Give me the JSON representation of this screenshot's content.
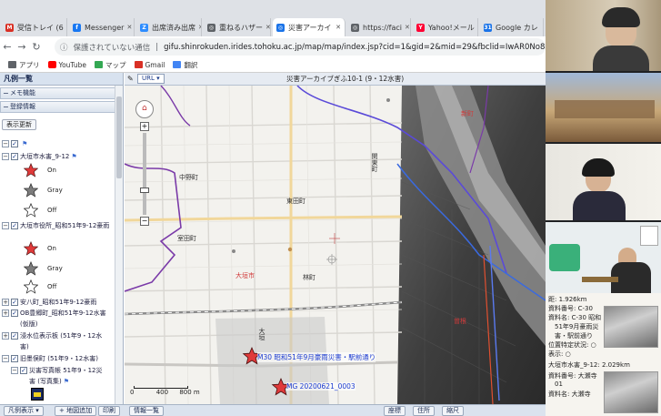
{
  "browser": {
    "tabs": [
      {
        "label": "受信トレイ (6",
        "icon": "gmail-icon",
        "color": "#d93025",
        "glyph": "M"
      },
      {
        "label": "Messenger",
        "icon": "facebook-icon",
        "color": "#1877f2",
        "glyph": "f"
      },
      {
        "label": "出席済み出席",
        "icon": "zoom-icon",
        "color": "#2d8cff",
        "glyph": "Z"
      },
      {
        "label": "重ねるハザー",
        "icon": "globe-icon",
        "color": "#5f6368",
        "glyph": "◎"
      },
      {
        "label": "災害アーカイ",
        "icon": "globe-icon",
        "color": "#1a73e8",
        "glyph": "◎"
      },
      {
        "label": "https://faci",
        "icon": "globe-icon",
        "color": "#5f6368",
        "glyph": "◎"
      },
      {
        "label": "Yahoo!メール",
        "icon": "yahoo-icon",
        "color": "#ff0033",
        "glyph": "Y"
      },
      {
        "label": "Google カレ",
        "icon": "calendar-icon",
        "color": "#1a73e8",
        "glyph": "31"
      }
    ],
    "security_label": "保護されていない通信",
    "url": "gifu.shinrokuden.irides.tohoku.ac.jp/map/map/index.jsp?cid=1&gid=2&mid=29&fbclid=IwAR0No8aXD45Rlp5mRfqQPr1QYL",
    "bookmarks": [
      {
        "label": "アプリ",
        "color": "#5f6368"
      },
      {
        "label": "YouTube",
        "color": "#ff0000"
      },
      {
        "label": "マップ",
        "color": "#34a853"
      },
      {
        "label": "Gmail",
        "color": "#d93025"
      },
      {
        "label": "翻訳",
        "color": "#4285f4"
      }
    ]
  },
  "legend": {
    "title": "凡例一覧",
    "memo_section": "メモ機能",
    "register_section": "登録情報",
    "refresh_button": "表示更新",
    "layers": [
      {
        "label": "大垣市水害_9-12",
        "checked": true
      },
      {
        "label": "大垣市役所_昭和51年9-12豪雨",
        "checked": true
      },
      {
        "label": "安八町_昭和51年9-12豪雨",
        "checked": true
      },
      {
        "label": "OB豊郷町_昭和51年9-12水害",
        "checked": true
      },
      {
        "label": "(仮版)",
        "checked": false
      },
      {
        "label": "浸水位表示板 (51年9・12水",
        "checked": true
      },
      {
        "label": "害)",
        "checked": false
      },
      {
        "label": "旧墨俣町 (51年9・12水害)",
        "checked": true
      },
      {
        "label": "災害写真帳 51年9・12災",
        "checked": true
      },
      {
        "label": "害 (写真集)",
        "checked": false
      }
    ],
    "star_states": [
      "On",
      "Gray",
      "Off"
    ],
    "bottom_label": "凡例表示"
  },
  "map": {
    "url_button": "URL",
    "title": "災害アーカイブぎふ10-1 (9・12水害)",
    "places": [
      {
        "label": "中野町"
      },
      {
        "label": "東田町"
      },
      {
        "label": "室田町"
      },
      {
        "label": "大垣市"
      },
      {
        "label": "林町"
      },
      {
        "label": "関東町"
      },
      {
        "label": "大垣"
      },
      {
        "label": "新町"
      },
      {
        "label": "曽根"
      }
    ],
    "markers": [
      {
        "label": "M30 昭和51年9月豪雨災害・駅前通り"
      },
      {
        "label": "MG 20200621_0003"
      }
    ],
    "scale": {
      "zero": "0",
      "mid": "400",
      "end": "800 m"
    }
  },
  "statusbar": {
    "buttons": [
      "凡例表示",
      "地図追加",
      "印刷",
      "情報一覧"
    ],
    "right_buttons": [
      "座標",
      "住所",
      "縮尺"
    ]
  },
  "info_panel": {
    "lines": [
      "距: 1.926km",
      "資料番号: C-30",
      "資料名: C-30 昭和",
      "51年9月豪雨災",
      "害・駅前通り",
      "位置特定状況: ○",
      "表示: ○",
      "大垣市水害_9-12: 2.029km",
      "資料番号: 大瀬寺",
      "01",
      "資料名: 大瀬寺"
    ]
  },
  "colors": {
    "accent_purple": "#7a3aa8",
    "marker_red": "#e03a3a",
    "link_blue": "#1a3ad0"
  }
}
